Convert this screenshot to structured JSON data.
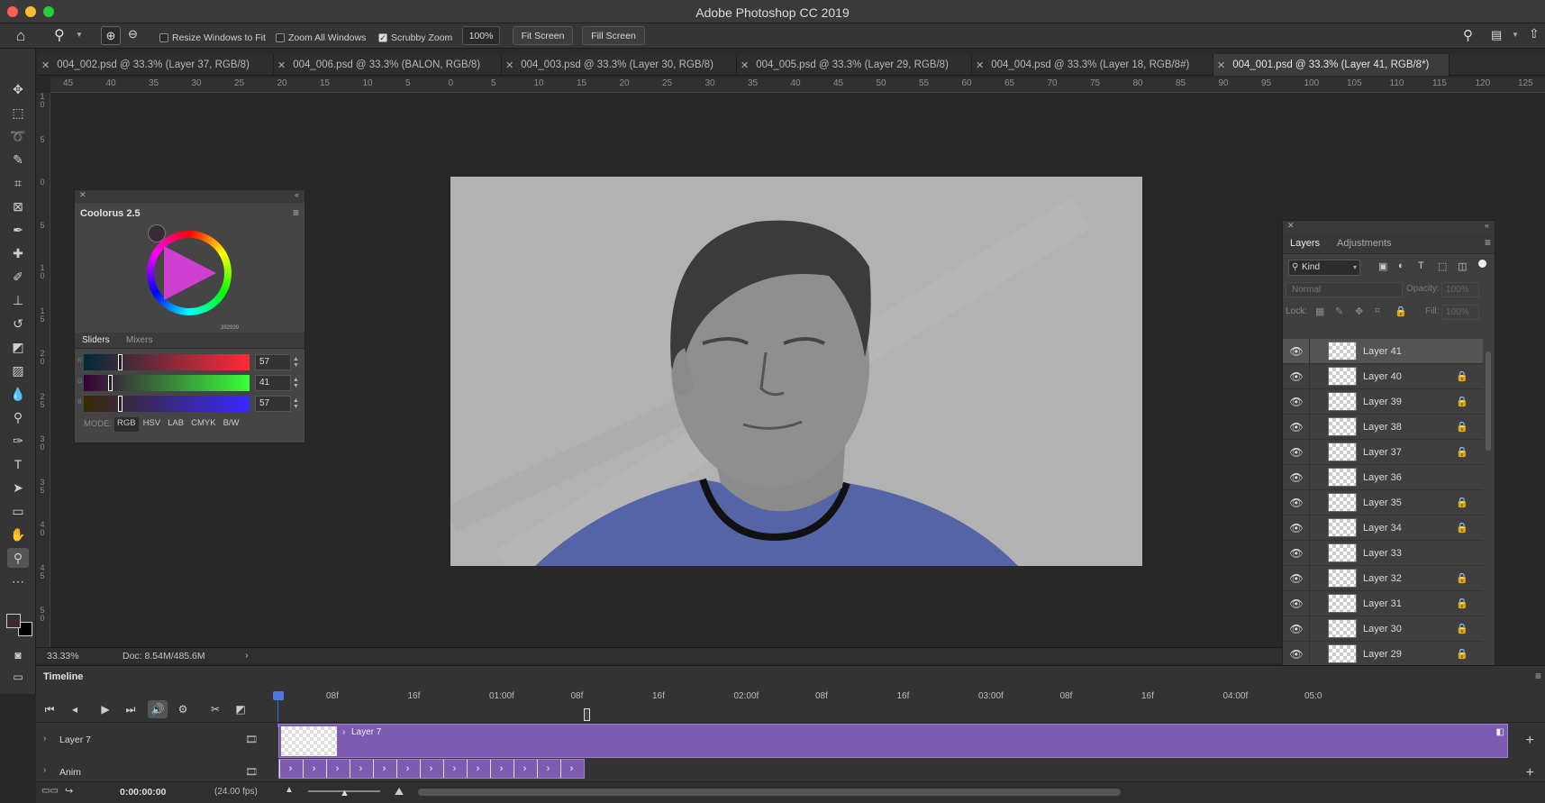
{
  "app": {
    "title": "Adobe Photoshop CC 2019"
  },
  "options": {
    "resize_windows": "Resize Windows to Fit",
    "zoom_all": "Zoom All Windows",
    "scrubby": "Scrubby Zoom",
    "zoom_value": "100%",
    "fit_screen": "Fit Screen",
    "fill_screen": "Fill Screen"
  },
  "tabs": [
    {
      "label": "004_002.psd @ 33.3% (Layer 37, RGB/8)"
    },
    {
      "label": "004_006.psd @ 33.3% (BALON, RGB/8)"
    },
    {
      "label": "004_003.psd @ 33.3% (Layer 30, RGB/8)"
    },
    {
      "label": "004_005.psd @ 33.3% (Layer 29, RGB/8)"
    },
    {
      "label": "004_004.psd @ 33.3% (Layer 18, RGB/8#)"
    },
    {
      "label": "004_001.psd @ 33.3% (Layer 41, RGB/8*)"
    }
  ],
  "ruler": {
    "h": [
      "45",
      "40",
      "35",
      "30",
      "25",
      "20",
      "15",
      "10",
      "5",
      "0",
      "5",
      "10",
      "15",
      "20",
      "25",
      "30",
      "35",
      "40",
      "45",
      "50",
      "55",
      "60",
      "65",
      "70",
      "75",
      "80",
      "85",
      "90",
      "95",
      "100",
      "105",
      "110",
      "115",
      "120",
      "125"
    ],
    "v": [
      "1 0",
      "5",
      "0",
      "5",
      "1 0",
      "1 5",
      "2 0",
      "2 5",
      "3 0",
      "3 5",
      "4 0",
      "4 5",
      "5 0"
    ]
  },
  "colour_panel": {
    "title": "Coolorus 2.5",
    "tab_sliders": "Sliders",
    "tab_mixers": "Mixers",
    "hex": "392939",
    "sliders": [
      {
        "ch": "R",
        "value": "57",
        "level": 0.22
      },
      {
        "ch": "G",
        "value": "41",
        "level": 0.16
      },
      {
        "ch": "B",
        "value": "57",
        "level": 0.22
      }
    ],
    "mode_label": "MODE:",
    "modes": [
      "RGB",
      "HSV",
      "LAB",
      "CMYK",
      "B/W"
    ],
    "current_color": "#392939"
  },
  "layers_panel": {
    "tab_layers": "Layers",
    "tab_adjustments": "Adjustments",
    "filter": "Kind",
    "blend": "Normal",
    "opacity_label": "Opacity:",
    "opacity_value": "100%",
    "lock_label": "Lock:",
    "fill_label": "Fill:",
    "fill_value": "100%",
    "layers": [
      {
        "name": "Layer 41",
        "locked": false,
        "selected": true
      },
      {
        "name": "Layer 40",
        "locked": true
      },
      {
        "name": "Layer 39",
        "locked": true
      },
      {
        "name": "Layer 38",
        "locked": true
      },
      {
        "name": "Layer 37",
        "locked": true
      },
      {
        "name": "Layer 36",
        "locked": false
      },
      {
        "name": "Layer 35",
        "locked": true
      },
      {
        "name": "Layer 34",
        "locked": true
      },
      {
        "name": "Layer 33",
        "locked": false
      },
      {
        "name": "Layer 32",
        "locked": true
      },
      {
        "name": "Layer 31",
        "locked": true
      },
      {
        "name": "Layer 30",
        "locked": true
      },
      {
        "name": "Layer 29",
        "locked": true
      }
    ]
  },
  "status": {
    "zoom": "33.33%",
    "doc": "Doc: 8.54M/485.6M"
  },
  "timeline": {
    "title": "Timeline",
    "ticks": [
      "08f",
      "16f",
      "01:00f",
      "08f",
      "16f",
      "02:00f",
      "08f",
      "16f",
      "03:00f",
      "08f",
      "16f",
      "04:00f",
      "05:0"
    ],
    "track1": "Layer 7",
    "clip_label": "Layer 7",
    "track2": "Anim",
    "timecode": "0:00:00:00",
    "fps": "(24.00 fps)"
  }
}
